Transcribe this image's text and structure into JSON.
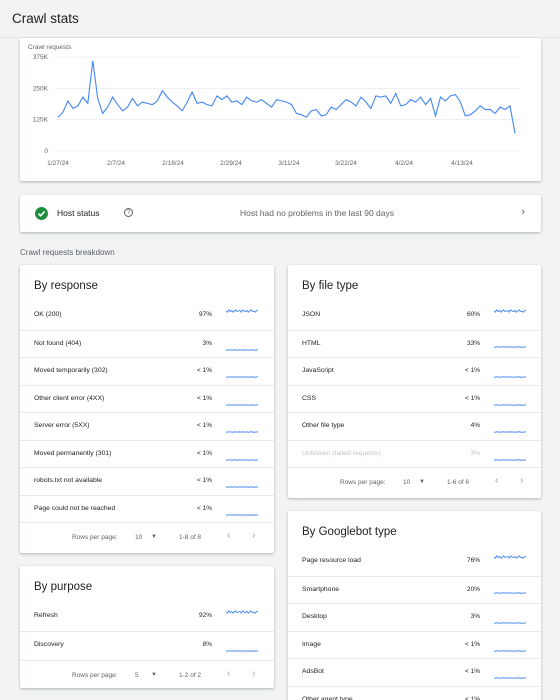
{
  "page_title": "Crawl stats",
  "chart_data": {
    "type": "line",
    "ylabel": "Crawl requests",
    "y_ticks": [
      "375K",
      "250K",
      "125K",
      "0"
    ],
    "x_ticks": [
      "1/27/24",
      "2/7/24",
      "2/18/24",
      "2/29/24",
      "3/11/24",
      "3/22/24",
      "4/2/24",
      "4/13/24"
    ],
    "ylim": [
      0,
      375000
    ],
    "grid": true,
    "color": "#4285f4",
    "series": [
      {
        "values": [
          135000,
          155000,
          200000,
          170000,
          180000,
          215000,
          190000,
          360000,
          210000,
          150000,
          175000,
          215000,
          185000,
          160000,
          175000,
          210000,
          180000,
          195000,
          190000,
          185000,
          200000,
          240000,
          215000,
          195000,
          180000,
          160000,
          195000,
          235000,
          190000,
          195000,
          185000,
          180000,
          220000,
          205000,
          220000,
          195000,
          200000,
          185000,
          215000,
          200000,
          195000,
          205000,
          190000,
          175000,
          205000,
          200000,
          195000,
          185000,
          150000,
          145000,
          135000,
          160000,
          165000,
          140000,
          145000,
          175000,
          165000,
          185000,
          205000,
          195000,
          180000,
          215000,
          195000,
          170000,
          220000,
          215000,
          220000,
          190000,
          230000,
          180000,
          185000,
          205000,
          195000,
          215000,
          185000,
          210000,
          140000,
          215000,
          200000,
          220000,
          225000,
          195000,
          140000,
          145000,
          160000,
          180000,
          165000,
          165000,
          150000,
          175000,
          165000,
          180000,
          70000
        ]
      }
    ]
  },
  "host_status": {
    "label": "Host status",
    "help": "?",
    "message": "Host had no problems in the last 90 days"
  },
  "breakdown_label": "Crawl requests breakdown",
  "by_response": {
    "title": "By response",
    "rows": [
      {
        "name": "OK (200)",
        "pct": "97%"
      },
      {
        "name": "Not found (404)",
        "pct": "3%"
      },
      {
        "name": "Moved temporarily (302)",
        "pct": "< 1%"
      },
      {
        "name": "Other client error (4XX)",
        "pct": "< 1%"
      },
      {
        "name": "Server error (5XX)",
        "pct": "< 1%"
      },
      {
        "name": "Moved permanently (301)",
        "pct": "< 1%"
      },
      {
        "name": "robots.txt not available",
        "pct": "< 1%"
      },
      {
        "name": "Page could not be reached",
        "pct": "< 1%"
      }
    ],
    "pager": {
      "rows_label": "Rows per page:",
      "rows_value": "10",
      "range": "1-8 of 8"
    }
  },
  "by_purpose": {
    "title": "By purpose",
    "rows": [
      {
        "name": "Refresh",
        "pct": "92%"
      },
      {
        "name": "Discovery",
        "pct": "8%"
      }
    ],
    "pager": {
      "rows_label": "Rows per page:",
      "rows_value": "5",
      "range": "1-2 of 2"
    }
  },
  "by_file_type": {
    "title": "By file type",
    "rows": [
      {
        "name": "JSON",
        "pct": "60%"
      },
      {
        "name": "HTML",
        "pct": "33%"
      },
      {
        "name": "JavaScript",
        "pct": "< 1%"
      },
      {
        "name": "CSS",
        "pct": "< 1%"
      },
      {
        "name": "Other file type",
        "pct": "4%"
      },
      {
        "name": "Unknown (failed requests)",
        "pct": "3%"
      }
    ],
    "pager": {
      "rows_label": "Rows per page:",
      "rows_value": "10",
      "range": "1-6 of 6"
    }
  },
  "by_googlebot": {
    "title": "By Googlebot type",
    "rows": [
      {
        "name": "Page resource load",
        "pct": "76%"
      },
      {
        "name": "Smartphone",
        "pct": "20%"
      },
      {
        "name": "Desktop",
        "pct": "3%"
      },
      {
        "name": "Image",
        "pct": "< 1%"
      },
      {
        "name": "AdsBot",
        "pct": "< 1%"
      },
      {
        "name": "Other agent type",
        "pct": "< 1%"
      }
    ]
  }
}
